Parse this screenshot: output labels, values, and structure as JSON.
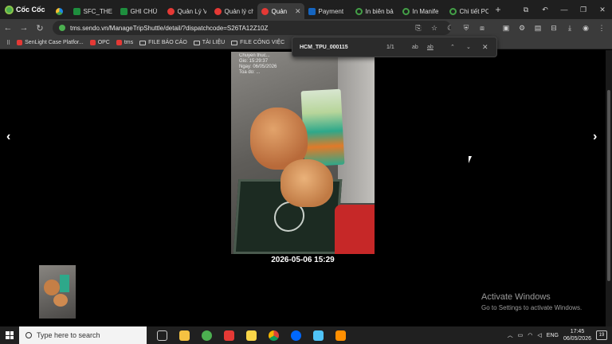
{
  "browser": {
    "brand": "Cốc Cốc",
    "tabs": [
      {
        "label": "",
        "icon": "drive-icon"
      },
      {
        "label": "SFC_THEO",
        "icon": "sheets-icon"
      },
      {
        "label": "GHI CHÚ",
        "icon": "sheets-icon"
      },
      {
        "label": "Quản Lý V",
        "icon": "sendo-icon"
      },
      {
        "label": "Quản lý ch",
        "icon": "sendo-icon"
      },
      {
        "label": "Quản",
        "icon": "sendo-icon",
        "active": true
      },
      {
        "label": "Payment",
        "icon": "payment-icon"
      },
      {
        "label": "In biên bả",
        "icon": "green-ring-icon"
      },
      {
        "label": "In Manife",
        "icon": "green-ring-icon"
      },
      {
        "label": "Chi tiết PC",
        "icon": "green-ring-icon"
      }
    ],
    "url": "tms.sendo.vn/ManageTripShuttle/detail/?dispatchcode=S26TA12Z10Z",
    "bookmarks": [
      {
        "label": "SenLight Case Platfor...",
        "icon": "sendo-icon"
      },
      {
        "label": "OPC",
        "icon": "sendo-icon"
      },
      {
        "label": "tms",
        "icon": "sendo-icon"
      },
      {
        "label": "FILE BÁO CÁO",
        "icon": "folder-icon"
      },
      {
        "label": "TÀI LIỆU",
        "icon": "folder-icon"
      },
      {
        "label": "FILE CÔNG VIỆC",
        "icon": "folder-icon"
      }
    ]
  },
  "findbar": {
    "query": "HCM_TPU_000115",
    "count": "1/1",
    "match_case": "ab",
    "whole_word": "ab"
  },
  "viewer": {
    "photo_stamp": "Chuyen thuc...\nGio: 15:29:37\nNgay: 06/05/2026\nToa do: ...",
    "caption": "2026-05-06 15:29",
    "prev_label": "‹",
    "next_label": "›"
  },
  "watermark": {
    "line1": "Activate Windows",
    "line2": "Go to Settings to activate Windows."
  },
  "taskbar": {
    "search_placeholder": "Type here to search",
    "time": "17:45",
    "date": "06/05/2026",
    "notifications": "19"
  },
  "colors": {
    "tab_bar": "#1f1f1f",
    "toolbar": "#3b3b3b",
    "viewer_bg": "#000000",
    "taskbar": "#202020"
  }
}
